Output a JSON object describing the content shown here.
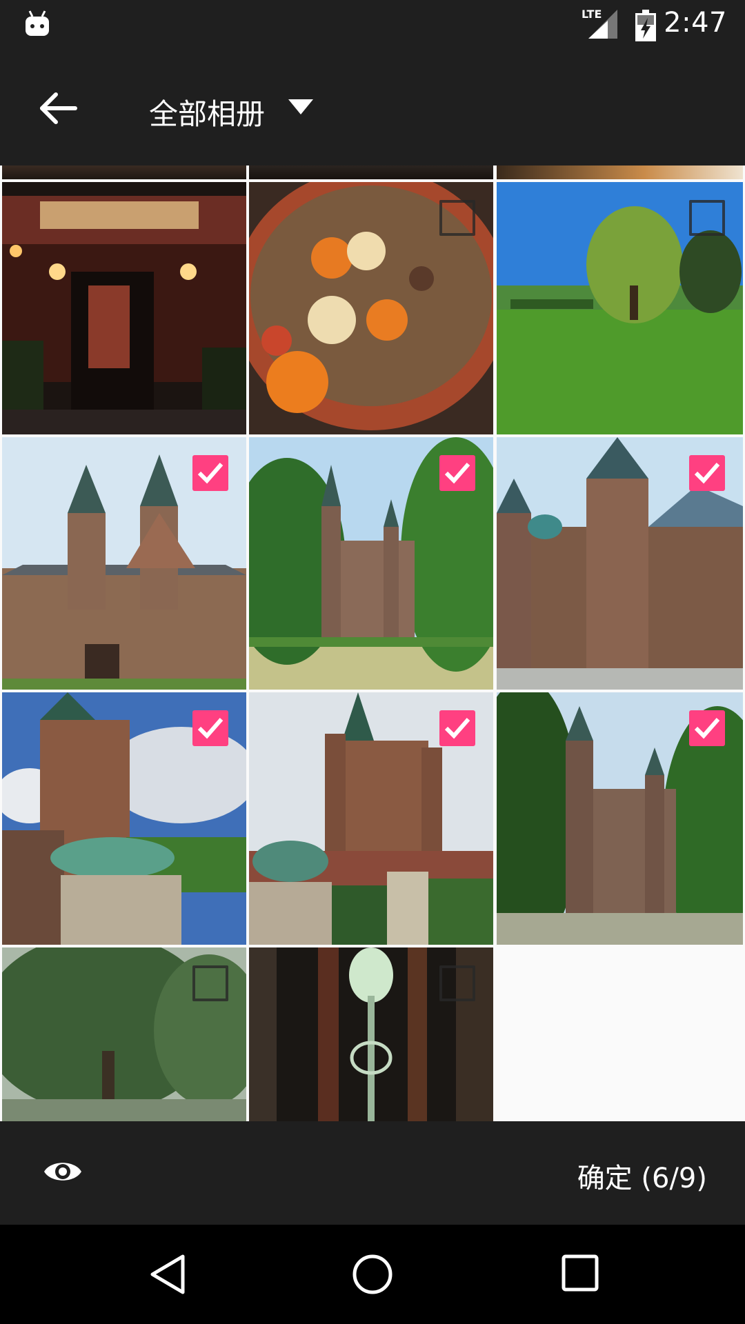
{
  "status_bar": {
    "time": "2:47",
    "network": "LTE"
  },
  "app_bar": {
    "title": "全部相册"
  },
  "photos": [
    {
      "subject": "restaurant entrance at night",
      "selected": false
    },
    {
      "subject": "lentil stew",
      "selected": false
    },
    {
      "subject": "willow tree in park",
      "selected": false
    },
    {
      "subject": "castle facade",
      "selected": true
    },
    {
      "subject": "castle between trees",
      "selected": true
    },
    {
      "subject": "castle towers",
      "selected": true
    },
    {
      "subject": "castle with lion statue",
      "selected": true
    },
    {
      "subject": "castle gate with lion statue",
      "selected": true
    },
    {
      "subject": "castle across lawn",
      "selected": true
    },
    {
      "subject": "large tree in park",
      "selected": false
    },
    {
      "subject": "ornate glass lamp",
      "selected": false
    }
  ],
  "action_bar": {
    "confirm_label": "确定 (6/9)"
  },
  "colors": {
    "bars": "#1f1f1f",
    "accent": "#ff4081",
    "navbar": "#000000"
  }
}
